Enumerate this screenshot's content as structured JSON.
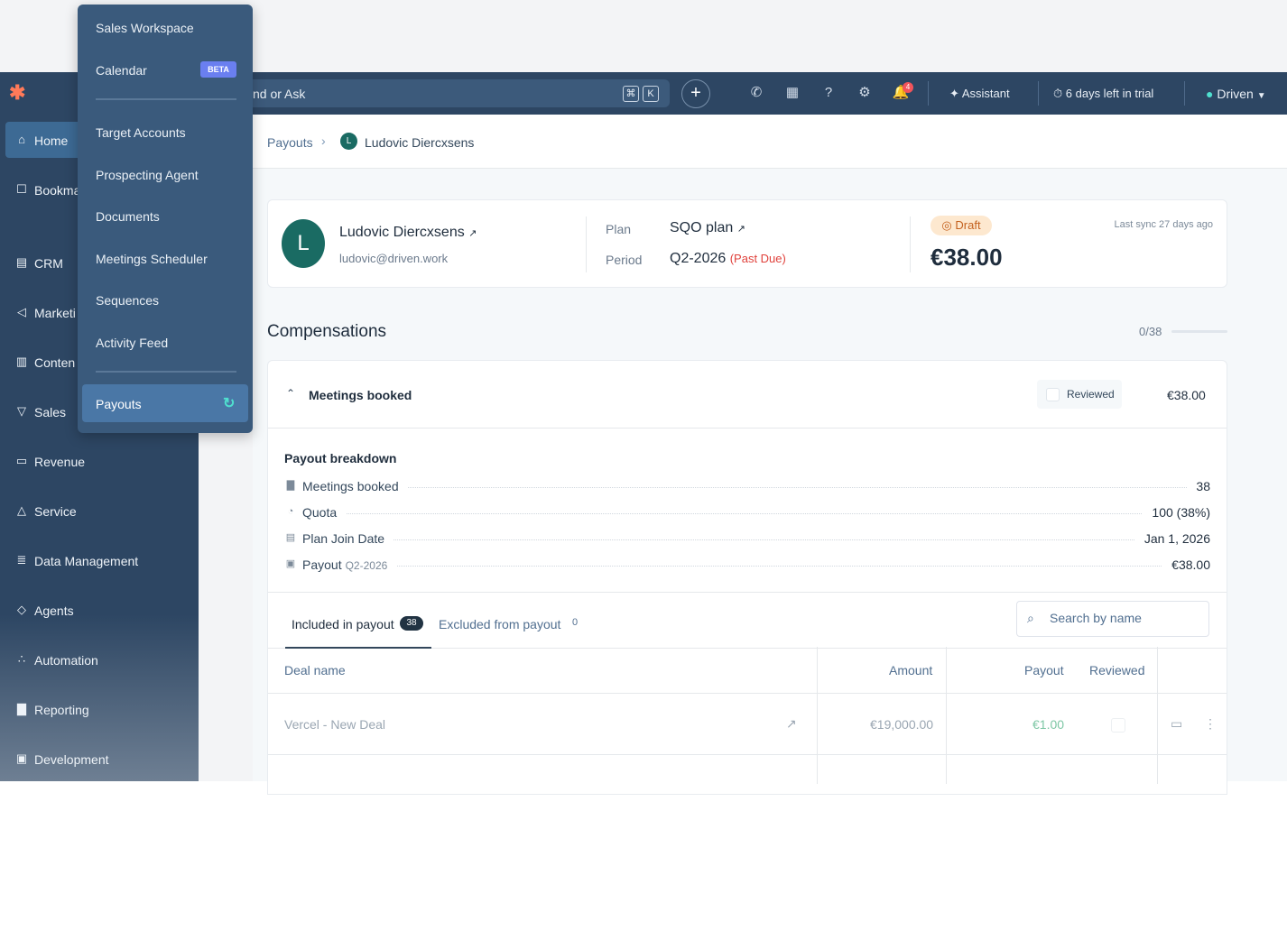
{
  "topbar": {
    "search_placeholder": "nd or Ask",
    "kbd_cmd": "⌘",
    "kbd_k": "K",
    "assistant_label": "Assistant",
    "trial_label": "6 days left in trial",
    "account_label": "Driven",
    "notification_count": "4"
  },
  "sidebar": {
    "items": [
      {
        "label": "Home",
        "icon": "home-icon"
      },
      {
        "label": "Bookma",
        "icon": "bookmark-icon"
      },
      {
        "label": "CRM",
        "icon": "crm-icon"
      },
      {
        "label": "Marketi",
        "icon": "megaphone-icon"
      },
      {
        "label": "Conten",
        "icon": "content-icon"
      },
      {
        "label": "Sales",
        "icon": "sales-icon"
      },
      {
        "label": "Revenue",
        "icon": "revenue-icon"
      },
      {
        "label": "Service",
        "icon": "service-icon"
      },
      {
        "label": "Data Management",
        "icon": "database-icon"
      },
      {
        "label": "Agents",
        "icon": "agents-icon"
      },
      {
        "label": "Automation",
        "icon": "automation-icon"
      },
      {
        "label": "Reporting",
        "icon": "reporting-icon"
      },
      {
        "label": "Development",
        "icon": "development-icon"
      }
    ]
  },
  "flyout": {
    "items": [
      "Sales Workspace",
      "Calendar",
      "Target Accounts",
      "Prospecting Agent",
      "Documents",
      "Meetings Scheduler",
      "Sequences",
      "Activity Feed"
    ],
    "beta_label": "BETA",
    "active_item": "Payouts"
  },
  "breadcrumb": {
    "root": "Payouts",
    "current": "Ludovic Diercxsens",
    "avatar_initial": "L"
  },
  "header_card": {
    "avatar_initial": "L",
    "name": "Ludovic Diercxsens",
    "email": "ludovic@driven.work",
    "plan_label": "Plan",
    "plan_value": "SQO plan",
    "period_label": "Period",
    "period_value": "Q2-2026",
    "period_status": "(Past Due)",
    "status_badge": "Draft",
    "amount": "€38.00",
    "last_sync": "Last sync 27 days ago"
  },
  "compensations": {
    "title": "Compensations",
    "progress_text": "0/38",
    "progress_fraction": 0
  },
  "comp_item": {
    "title": "Meetings booked",
    "reviewed_label": "Reviewed",
    "amount": "€38.00"
  },
  "breakdown": {
    "title": "Payout breakdown",
    "rows": [
      {
        "label": "Meetings booked",
        "sub": "",
        "value": "38",
        "icon": "chart-icon"
      },
      {
        "label": "Quota",
        "sub": "",
        "value": "100 (38%)",
        "icon": "quota-icon"
      },
      {
        "label": "Plan Join Date",
        "sub": "",
        "value": "Jan 1, 2026",
        "icon": "calendar-icon"
      },
      {
        "label": "Payout",
        "sub": "Q2-2026",
        "value": "€38.00",
        "icon": "wallet-icon"
      }
    ]
  },
  "tabs": {
    "included_label": "Included in payout",
    "included_count": "38",
    "excluded_label": "Excluded from payout",
    "excluded_count": "0",
    "search_placeholder": "Search by name"
  },
  "table": {
    "headers": [
      "Deal name",
      "Amount",
      "Payout",
      "Reviewed"
    ],
    "rows": [
      {
        "deal": "Vercel - New Deal",
        "amount": "€19,000.00",
        "payout": "€1.00"
      }
    ]
  }
}
